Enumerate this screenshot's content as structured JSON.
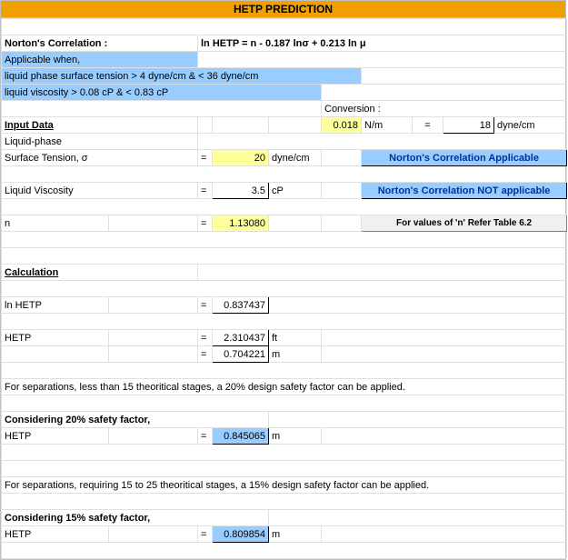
{
  "title": "HETP PREDICTION",
  "correlation": {
    "label": "Norton's Correlation :",
    "equation": "ln HETP  =  n - 0.187 lnσ   +  0.213 ln  μ",
    "applicable_heading": "Applicable when,",
    "cond1": "liquid phase surface tension   > 4 dyne/cm & < 36 dyne/cm",
    "cond2": "liquid viscosity  > 0.08 cP & < 0.83 cP"
  },
  "conversion": {
    "label": "Conversion :",
    "value": "0.018",
    "unit1": "N/m",
    "eq": "=",
    "value2": "18",
    "unit2": "dyne/cm"
  },
  "input": {
    "heading": "Input Data",
    "liquid_phase": "Liquid-phase",
    "surface_tension_label": "Surface Tension,  σ",
    "surface_tension_eq": "=",
    "surface_tension_value": "20",
    "surface_tension_unit": "dyne/cm",
    "viscosity_label": "Liquid Viscosity",
    "viscosity_eq": "=",
    "viscosity_value": "3.5",
    "viscosity_unit": "cP",
    "n_label": "n",
    "n_eq": "=",
    "n_value": "1.13080"
  },
  "status": {
    "applicable": "Norton's Correlation Applicable",
    "not_applicable": "Norton's Correlation NOT applicable",
    "refer_table": "For values of 'n' Refer Table 6.2"
  },
  "calc": {
    "heading": "Calculation",
    "lnhetp_label": "ln HETP",
    "lnhetp_eq": "=",
    "lnhetp_value": "0.837437",
    "hetp_label": "HETP",
    "hetp_eq": "=",
    "hetp_ft": "2.310437",
    "hetp_ft_unit": "ft",
    "hetp_m_eq": "=",
    "hetp_m": "0.704221",
    "hetp_m_unit": "m"
  },
  "note20": "For separations, less than 15 theoritical stages, a 20% design safety factor can be applied.",
  "sf20": {
    "heading": "Considering 20% safety factor,",
    "label": "HETP",
    "eq": "=",
    "value": "0.845065",
    "unit": "m"
  },
  "note15": "For separations, requiring 15 to 25 theoritical stages, a 15% design safety factor can be applied.",
  "sf15": {
    "heading": "Considering 15% safety factor,",
    "label": "HETP",
    "eq": "=",
    "value": "0.809854",
    "unit": "m"
  }
}
